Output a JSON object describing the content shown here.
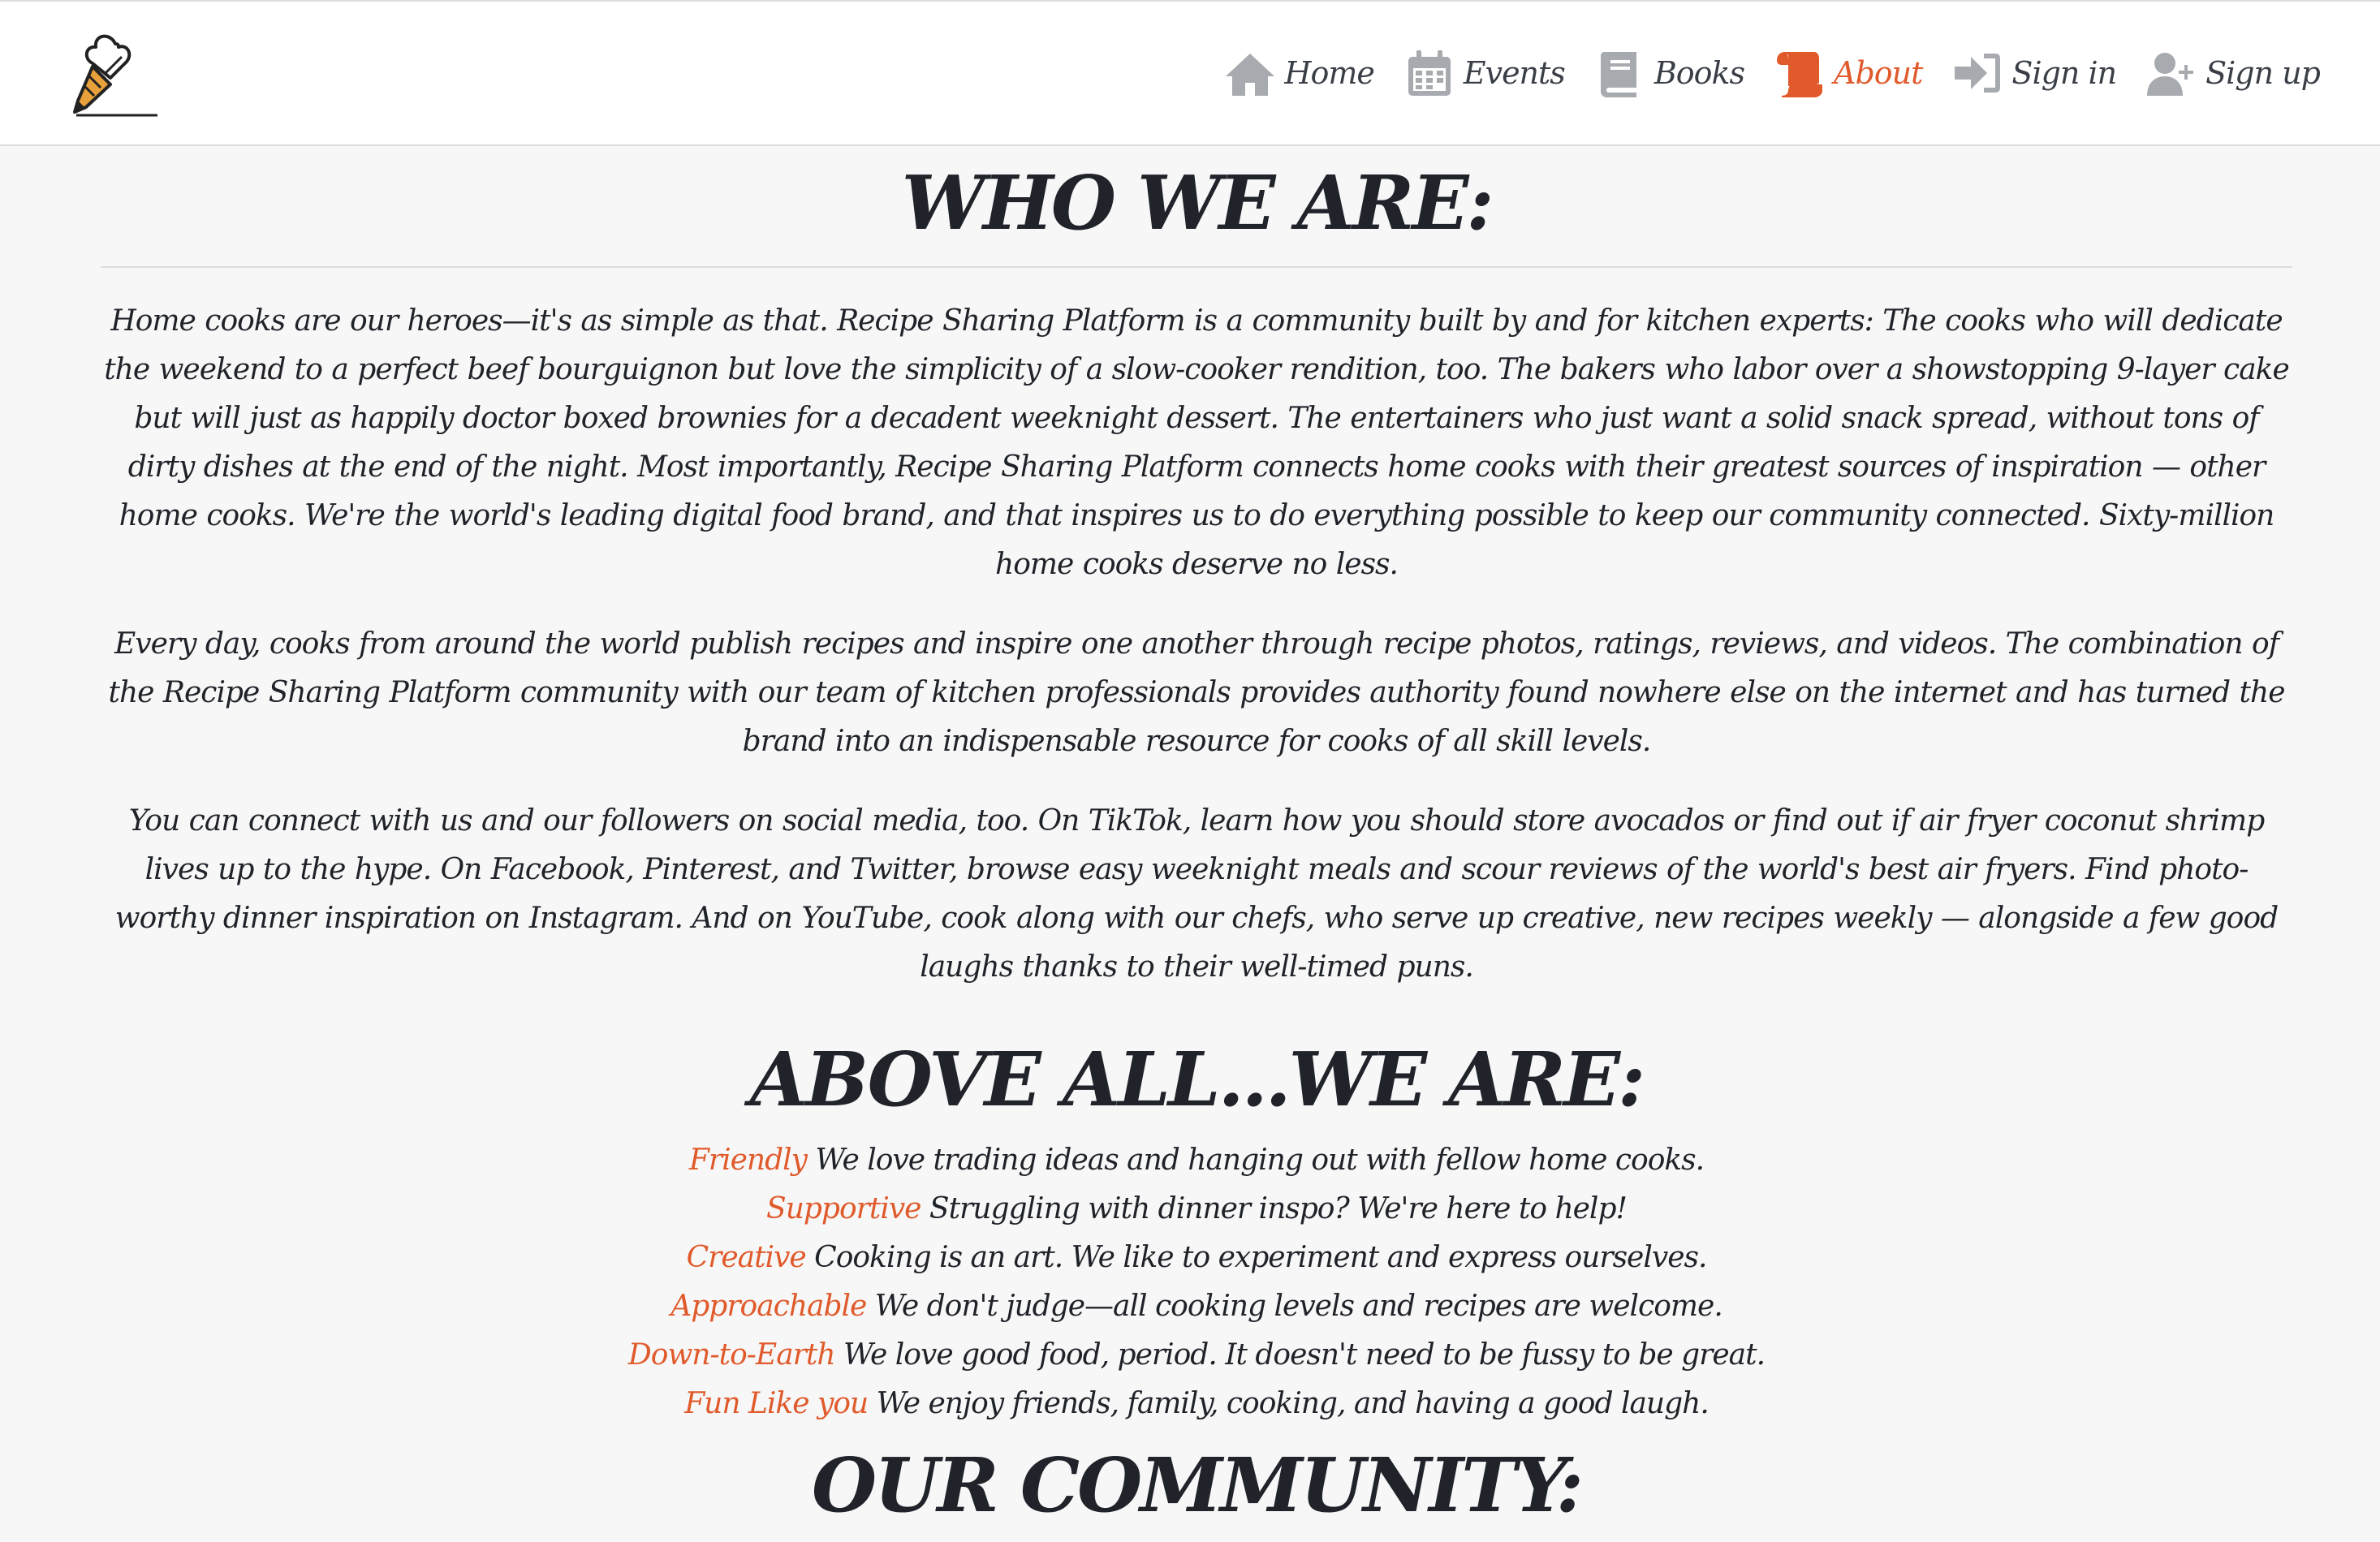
{
  "nav": {
    "items": [
      {
        "label": "Home",
        "icon": "home-icon",
        "active": false
      },
      {
        "label": "Events",
        "icon": "calendar-icon",
        "active": false
      },
      {
        "label": "Books",
        "icon": "book-icon",
        "active": false
      },
      {
        "label": "About",
        "icon": "scroll-icon",
        "active": true
      },
      {
        "label": "Sign in",
        "icon": "sign-in-icon",
        "active": false
      },
      {
        "label": "Sign up",
        "icon": "user-plus-icon",
        "active": false
      }
    ]
  },
  "colors": {
    "accent": "#e05a2b",
    "text": "#1f2329",
    "icon_gray": "#a7aaaf",
    "background": "#f7f7f7"
  },
  "who": {
    "title": "WHO WE ARE:",
    "paragraphs": [
      "Home cooks are our heroes—it's as simple as that. Recipe Sharing Platform is a community built by and for kitchen experts: The cooks who will dedicate the weekend to a perfect beef bourguignon but love the simplicity of a slow-cooker rendition, too. The bakers who labor over a showstopping 9-layer cake but will just as happily doctor boxed brownies for a decadent weeknight dessert. The entertainers who just want a solid snack spread, without tons of dirty dishes at the end of the night. Most importantly, Recipe Sharing Platform connects home cooks with their greatest sources of inspiration — other home cooks. We're the world's leading digital food brand, and that inspires us to do everything possible to keep our community connected. Sixty-million home cooks deserve no less.",
      "Every day, cooks from around the world publish recipes and inspire one another through recipe photos, ratings, reviews, and videos. The combination of the Recipe Sharing Platform community with our team of kitchen professionals provides authority found nowhere else on the internet and has turned the brand into an indispensable resource for cooks of all skill levels.",
      "You can connect with us and our followers on social media, too. On TikTok, learn how you should store avocados or find out if air fryer coconut shrimp lives up to the hype. On Facebook, Pinterest, and Twitter, browse easy weeknight meals and scour reviews of the world's best air fryers. Find photo-worthy dinner inspiration on Instagram. And on YouTube, cook along with our chefs, who serve up creative, new recipes weekly — alongside a few good laughs thanks to their well-timed puns."
    ]
  },
  "above": {
    "title": "ABOVE ALL...WE ARE:",
    "values": [
      {
        "keyword": "Friendly",
        "text": " We love trading ideas and hanging out with fellow home cooks."
      },
      {
        "keyword": "Supportive",
        "text": " Struggling with dinner inspo? We're here to help!"
      },
      {
        "keyword": "Creative",
        "text": " Cooking is an art. We like to experiment and express ourselves."
      },
      {
        "keyword": "Approachable",
        "text": " We don't judge—all cooking levels and recipes are welcome."
      },
      {
        "keyword": "Down-to-Earth",
        "text": " We love good food, period. It doesn't need to be fussy to be great."
      },
      {
        "keyword": "Fun Like you",
        "text": " We enjoy friends, family, cooking, and having a good laugh."
      }
    ]
  },
  "community": {
    "title": "OUR COMMUNITY:"
  }
}
